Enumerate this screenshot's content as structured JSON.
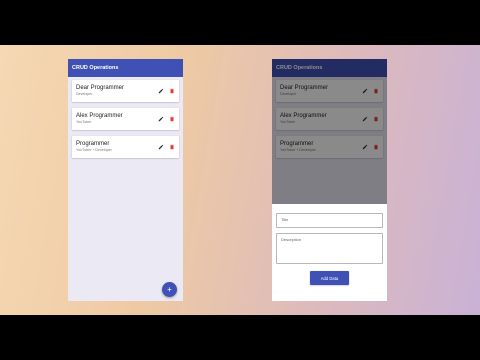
{
  "app": {
    "title": "CRUD Operations"
  },
  "notes": [
    {
      "title": "Dear Programmer",
      "subtitle": "Developer"
    },
    {
      "title": "Alex Programmer",
      "subtitle": "YouTuber"
    },
    {
      "title": "Programmer",
      "subtitle": "YouTuber + Developer"
    }
  ],
  "fab": {
    "label": "+"
  },
  "form": {
    "title_placeholder": "Title",
    "description_placeholder": "Description",
    "submit_label": "Add Data"
  },
  "colors": {
    "primary": "#3f51b5",
    "delete": "#e53935",
    "edit": "#263238"
  },
  "icons": {
    "edit": "pencil-icon",
    "delete": "trash-icon",
    "fab": "plus-icon"
  }
}
